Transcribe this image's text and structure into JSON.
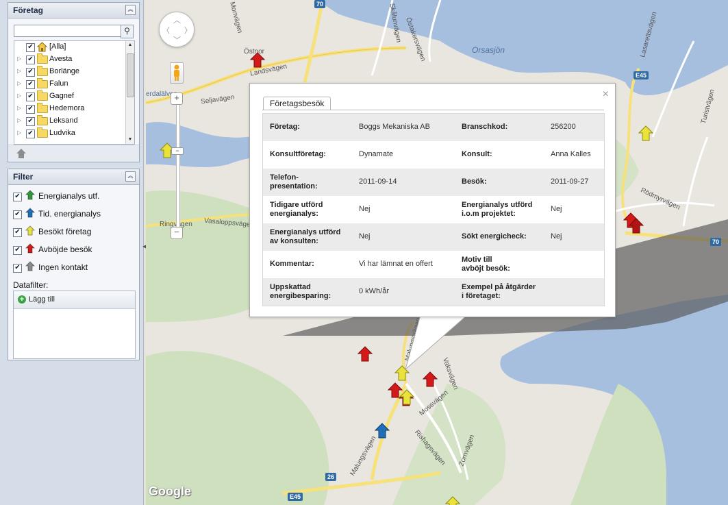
{
  "sidebar": {
    "foretag_panel": {
      "title": "Företag",
      "search": {
        "value": "",
        "placeholder": ""
      },
      "tree_items": [
        {
          "label": "[Alla]",
          "checked": true,
          "icon": "home-icon"
        },
        {
          "label": "Avesta",
          "checked": true,
          "icon": "folder-icon"
        },
        {
          "label": "Borlänge",
          "checked": true,
          "icon": "folder-icon"
        },
        {
          "label": "Falun",
          "checked": true,
          "icon": "folder-icon"
        },
        {
          "label": "Gagnef",
          "checked": true,
          "icon": "folder-icon"
        },
        {
          "label": "Hedemora",
          "checked": true,
          "icon": "folder-icon"
        },
        {
          "label": "Leksand",
          "checked": true,
          "icon": "folder-icon"
        },
        {
          "label": "Ludvika",
          "checked": true,
          "icon": "folder-icon"
        }
      ]
    },
    "filter_panel": {
      "title": "Filter",
      "items": [
        {
          "label": "Energianalys utf.",
          "checked": true,
          "color": "#2e9a3a"
        },
        {
          "label": "Tid. energianalys",
          "checked": true,
          "color": "#1f6fb8"
        },
        {
          "label": "Besökt företag",
          "checked": true,
          "color": "#e8e23a"
        },
        {
          "label": "Avböjde besök",
          "checked": true,
          "color": "#d21a1a"
        },
        {
          "label": "Ingen kontakt",
          "checked": true,
          "color": "#8a8a8a"
        }
      ],
      "datafilter_label": "Datafilter:",
      "add_label": "Lägg till"
    }
  },
  "map": {
    "labels": {
      "ostnor": "Östnor",
      "landsvagen": "Landsvägen",
      "seljavagen": "Seljavägen",
      "erdalalven": "erdalälven",
      "monvagen": "Monvägen",
      "skalunvagen": "Skålunvägen",
      "ostakersvagen": "Östakersvägen",
      "orsasjon": "Orsasjön",
      "lasarettsvagen": "Lasarettsvägen",
      "turistvagen": "Turistvägen",
      "rodmyrvagen": "Rödmyrvägen",
      "vasaloppsvagen": "Vasaloppsvägen",
      "ringvagen": "Ringvägen",
      "malungsvagen": "Malungsvägen",
      "mossvagen": "Mossvägen",
      "rishagsvagen": "Rishagsvägen",
      "zornvagen": "Zornvägen",
      "malungsvagen2": "Malungsvägen",
      "vaksvagen": "Vaksvägen"
    },
    "shields": {
      "r70_top": "70",
      "e45_right": "E45",
      "r70_right": "70",
      "r26": "26",
      "e45_bottom": "E45"
    },
    "google": "Google",
    "popup": {
      "tab": "Företagsbesök",
      "close": "×",
      "rows": [
        {
          "l1": "Företag:",
          "v1": "Boggs Mekaniska AB",
          "l2": "Branschkod:",
          "v2": "256200"
        },
        {
          "l1": "Konsultföretag:",
          "v1": "Dynamate",
          "l2": "Konsult:",
          "v2": "Anna Kalles"
        },
        {
          "l1": "Telefon-\npresentation:",
          "v1": "2011-09-14",
          "l2": "Besök:",
          "v2": "2011-09-27"
        },
        {
          "l1": "Tidigare utförd\nenergianalys:",
          "v1": "Nej",
          "l2": "Energianalys utförd\ni.o.m projektet:",
          "v2": "Nej"
        },
        {
          "l1": "Energianalys utförd\nav konsulten:",
          "v1": "Nej",
          "l2": "Sökt energicheck:",
          "v2": "Nej"
        },
        {
          "l1": "Kommentar:",
          "v1": "Vi har lämnat en offert",
          "l2": "Motiv till\navböjt besök:",
          "v2": ""
        },
        {
          "l1": "Uppskattad\nenergibesparing:",
          "v1": "0 kWh/år",
          "l2": "Exempel på åtgärder\ni företaget:",
          "v2": ""
        }
      ]
    }
  }
}
